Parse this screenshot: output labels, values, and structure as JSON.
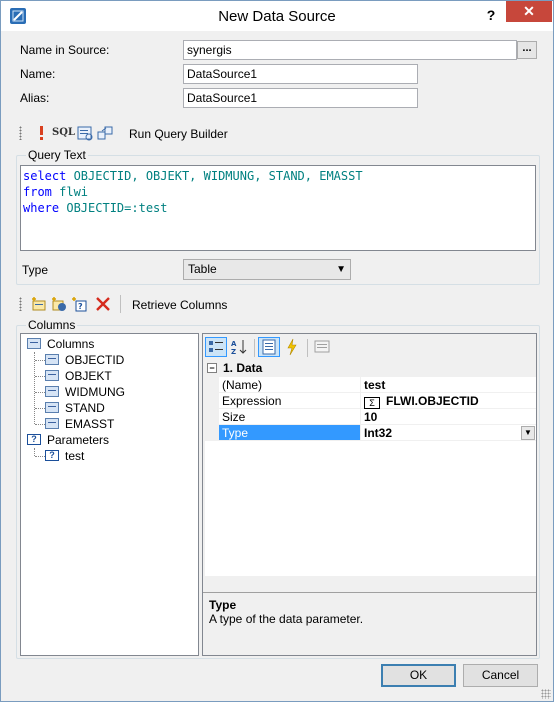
{
  "window": {
    "title": "New Data Source",
    "help_glyph": "?",
    "close_glyph": "✕"
  },
  "form": {
    "name_in_source_label": "Name in Source:",
    "name_in_source_value": "synergis",
    "browse_label": "...",
    "name_label": "Name:",
    "name_value": "DataSource1",
    "alias_label": "Alias:",
    "alias_value": "DataSource1"
  },
  "query_toolbar": {
    "icons": [
      "exclamation-icon",
      "sql-icon",
      "query-editor-icon",
      "wizard-icon"
    ],
    "sql_icon_text": "SQL",
    "run_query_builder_label": "Run Query Builder"
  },
  "query_text": {
    "group_label": "Query Text",
    "lines": [
      [
        {
          "t": "select ",
          "c": "kw"
        },
        {
          "t": "OBJECTID, OBJEKT, WIDMUNG, STAND, EMASST",
          "c": "id"
        }
      ],
      [
        {
          "t": "from ",
          "c": "kw"
        },
        {
          "t": "flwi",
          "c": "id"
        }
      ],
      [
        {
          "t": "where ",
          "c": "kw"
        },
        {
          "t": "OBJECTID=:test",
          "c": "id"
        }
      ]
    ]
  },
  "type_field": {
    "label": "Type",
    "value": "Table"
  },
  "columns_toolbar": {
    "icons": [
      "add-column-icon",
      "add-calculated-column-icon",
      "add-parameter-icon",
      "delete-icon"
    ],
    "retrieve_columns_label": "Retrieve Columns"
  },
  "columns": {
    "group_label": "Columns",
    "tree": {
      "columns_node": "Columns",
      "column_items": [
        "OBJECTID",
        "OBJEKT",
        "WIDMUNG",
        "STAND",
        "EMASST"
      ],
      "parameters_node": "Parameters",
      "parameter_items": [
        "test"
      ]
    }
  },
  "property_grid": {
    "toolbar_icons": [
      "categorized-icon",
      "alphabetical-icon",
      "properties-icon",
      "events-icon",
      "property-pages-icon"
    ],
    "category": "1. Data",
    "rows": [
      {
        "name": "(Name)",
        "value": "test"
      },
      {
        "name": "Expression",
        "value": "FLWI.OBJECTID"
      },
      {
        "name": "Size",
        "value": "10"
      },
      {
        "name": "Type",
        "value": "Int32"
      }
    ],
    "expression_icon_text": "Σ",
    "help_title": "Type",
    "help_text": "A type of the data parameter."
  },
  "buttons": {
    "ok": "OK",
    "cancel": "Cancel"
  },
  "colors": {
    "accent": "#3399ff",
    "close_button": "#c7473b",
    "sql_keyword": "#0000ff",
    "sql_identifier": "#008080"
  }
}
